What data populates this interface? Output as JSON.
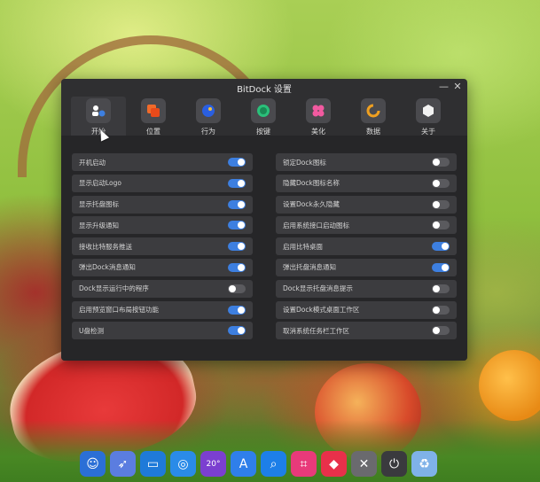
{
  "window": {
    "title": "BitDock 设置",
    "minimize_glyph": "—",
    "close_glyph": "✕"
  },
  "tabs": [
    {
      "label": "开始",
      "icon": "start-icon",
      "active": true
    },
    {
      "label": "位置",
      "icon": "position-icon",
      "active": false
    },
    {
      "label": "行为",
      "icon": "behavior-icon",
      "active": false
    },
    {
      "label": "按键",
      "icon": "keys-icon",
      "active": false
    },
    {
      "label": "美化",
      "icon": "beautify-icon",
      "active": false
    },
    {
      "label": "数据",
      "icon": "data-icon",
      "active": false
    },
    {
      "label": "关于",
      "icon": "about-icon",
      "active": false
    }
  ],
  "settings": {
    "left": [
      {
        "label": "开机启动",
        "on": true
      },
      {
        "label": "显示启动Logo",
        "on": true
      },
      {
        "label": "显示托盘图标",
        "on": true
      },
      {
        "label": "显示升级通知",
        "on": true
      },
      {
        "label": "接收比特服务推送",
        "on": true
      },
      {
        "label": "弹出Dock消息通知",
        "on": true
      },
      {
        "label": "Dock显示运行中的程序",
        "on": false
      },
      {
        "label": "启用预览窗口布局按钮功能",
        "on": true
      },
      {
        "label": "U盘检测",
        "on": true
      }
    ],
    "right": [
      {
        "label": "锁定Dock图标",
        "on": false
      },
      {
        "label": "隐藏Dock图标名称",
        "on": false
      },
      {
        "label": "设置Dock永久隐藏",
        "on": false
      },
      {
        "label": "启用系统接口启动图标",
        "on": false
      },
      {
        "label": "启用比特桌面",
        "on": true
      },
      {
        "label": "弹出托盘消息通知",
        "on": true
      },
      {
        "label": "Dock显示托盘消息提示",
        "on": false
      },
      {
        "label": "设置Dock模式桌面工作区",
        "on": false
      },
      {
        "label": "取消系统任务栏工作区",
        "on": false
      }
    ]
  },
  "dock": [
    {
      "name": "finder-icon",
      "glyph": "☺",
      "color": "#2b6fd6"
    },
    {
      "name": "launchpad-icon",
      "glyph": "➶",
      "color": "#5b7de0"
    },
    {
      "name": "desktop-icon",
      "glyph": "▭",
      "color": "#1f7ad9"
    },
    {
      "name": "safari-icon",
      "glyph": "◎",
      "color": "#2a8be8"
    },
    {
      "name": "weather-icon",
      "glyph": "20°",
      "color": "#7b3fd0"
    },
    {
      "name": "app-store-icon",
      "glyph": "A",
      "color": "#2f7fea"
    },
    {
      "name": "search-icon",
      "glyph": "⌕",
      "color": "#1d7fe8"
    },
    {
      "name": "screenshot-icon",
      "glyph": "⌗",
      "color": "#e83a7a"
    },
    {
      "name": "photos-icon",
      "glyph": "◆",
      "color": "#e8304a"
    },
    {
      "name": "calculator-icon",
      "glyph": "✕",
      "color": "#6a6a6e"
    },
    {
      "name": "power-icon",
      "glyph": "⏻",
      "color": "#3a3a3e"
    },
    {
      "name": "recycle-bin-icon",
      "glyph": "♻",
      "color": "#7fb2e8"
    }
  ],
  "colors": {
    "accent": "#3d7fe0",
    "toggle_off": "#5a5a5e"
  }
}
